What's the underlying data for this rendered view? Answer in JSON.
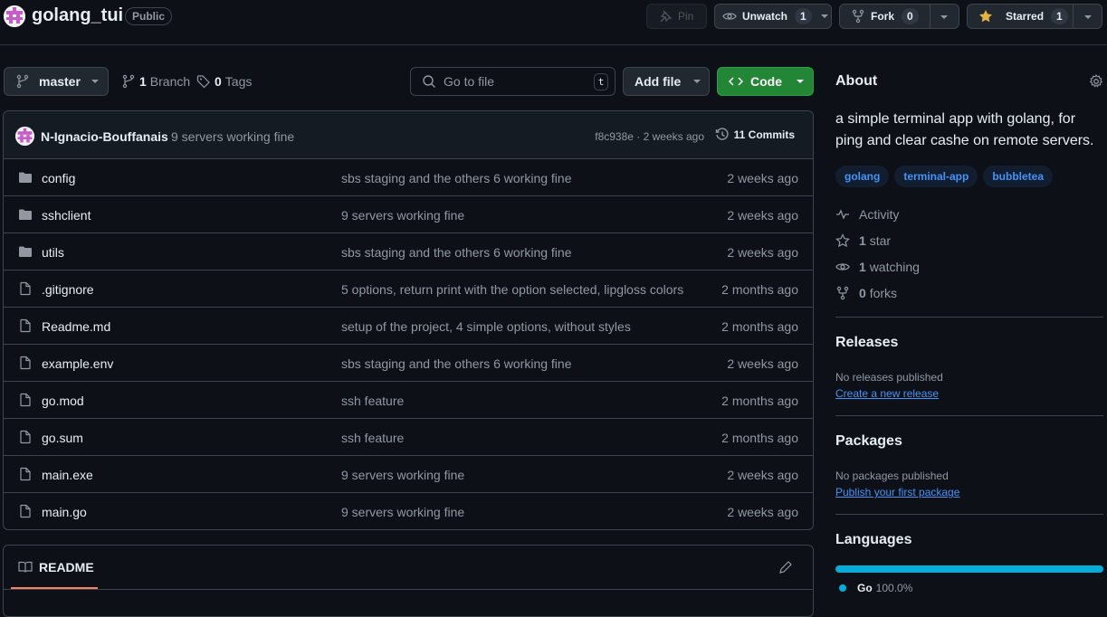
{
  "repo": {
    "name": "golang_tui",
    "visibility": "Public"
  },
  "actions": {
    "pin": "Pin",
    "watch": {
      "label": "Unwatch",
      "count": "1"
    },
    "fork": {
      "label": "Fork",
      "count": "0"
    },
    "star": {
      "label": "Starred",
      "count": "1"
    }
  },
  "toolbar": {
    "branch": "master",
    "branches_count": "1",
    "branches_label": "Branch",
    "tags_count": "0",
    "tags_label": "Tags",
    "search_placeholder": "Go to file",
    "search_shortcut": "t",
    "add_file": "Add file",
    "code": "Code"
  },
  "latest_commit": {
    "author": "N-Ignacio-Bouffanais",
    "message": "9 servers working fine",
    "meta": "f8c938e · 2 weeks ago",
    "commits_label": "11 Commits"
  },
  "files": [
    {
      "type": "folder",
      "name": "config",
      "message": "sbs staging and the others 6 working fine",
      "age": "2 weeks ago"
    },
    {
      "type": "folder",
      "name": "sshclient",
      "message": "9 servers working fine",
      "age": "2 weeks ago"
    },
    {
      "type": "folder",
      "name": "utils",
      "message": "sbs staging and the others 6 working fine",
      "age": "2 weeks ago"
    },
    {
      "type": "file",
      "name": ".gitignore",
      "message": "5 options, return print with the option selected, lipgloss colors",
      "age": "2 months ago"
    },
    {
      "type": "file",
      "name": "Readme.md",
      "message": "setup of the project, 4 simple options, without styles",
      "age": "2 months ago"
    },
    {
      "type": "file",
      "name": "example.env",
      "message": "sbs staging and the others 6 working fine",
      "age": "2 weeks ago"
    },
    {
      "type": "file",
      "name": "go.mod",
      "message": "ssh feature",
      "age": "2 months ago"
    },
    {
      "type": "file",
      "name": "go.sum",
      "message": "ssh feature",
      "age": "2 months ago"
    },
    {
      "type": "file",
      "name": "main.exe",
      "message": "9 servers working fine",
      "age": "2 weeks ago"
    },
    {
      "type": "file",
      "name": "main.go",
      "message": "9 servers working fine",
      "age": "2 weeks ago"
    }
  ],
  "readme": {
    "tab": "README"
  },
  "about": {
    "title": "About",
    "description": "a simple terminal app with golang, for ping and clear cashe on remote servers.",
    "topics": [
      "golang",
      "terminal-app",
      "bubbletea"
    ],
    "activity": "Activity",
    "stars": {
      "count": "1",
      "label": "star"
    },
    "watching": {
      "count": "1",
      "label": "watching"
    },
    "forks": {
      "count": "0",
      "label": "forks"
    }
  },
  "releases": {
    "title": "Releases",
    "empty": "No releases published",
    "link": "Create a new release"
  },
  "packages": {
    "title": "Packages",
    "empty": "No packages published",
    "link": "Publish your first package"
  },
  "languages": {
    "title": "Languages",
    "items": [
      {
        "name": "Go",
        "percent": "100.0%",
        "fraction": 1.0,
        "color": "#00add8"
      }
    ]
  },
  "colors": {
    "accent_green": "#238636",
    "link_blue": "#4493f8",
    "star_yellow": "#e3b341",
    "readme_underline": "#f78166",
    "go_lang": "#00add8"
  }
}
